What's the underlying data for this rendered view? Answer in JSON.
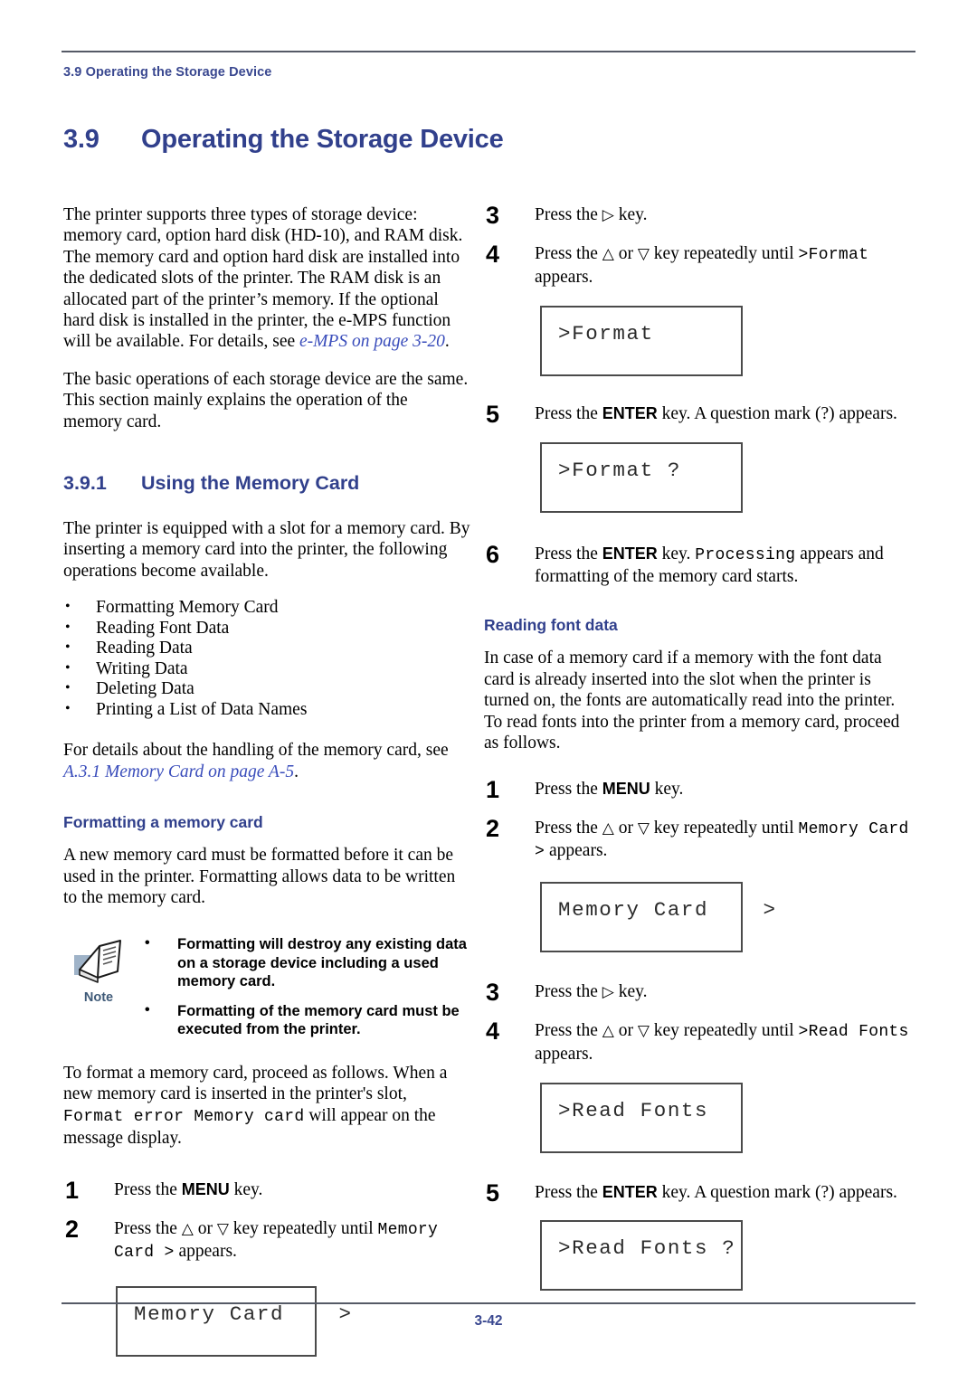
{
  "header": {
    "running_head": "3.9 Operating the Storage Device"
  },
  "section": {
    "number": "3.9",
    "title": "Operating the Storage Device"
  },
  "left_column": {
    "intro_paragraph_1": "The printer supports three types of storage device: memory card, option hard disk (HD-10), and RAM disk. The memory card and option hard disk are installed into the dedicated slots of the printer. The RAM disk is an allocated part of the printer’s memory. If the optional hard disk is installed in the printer, the e-MPS function will be available. For details, see ",
    "intro_xref_1": "e-MPS on page 3-20",
    "intro_paragraph_1_end": ".",
    "intro_paragraph_2": "The basic operations of each storage device are the same. This section mainly explains the operation of the memory card.",
    "subsection": {
      "number": "3.9.1",
      "title": "Using the Memory Card"
    },
    "using_paragraph": "The printer is equipped with a slot for a memory card. By inserting a memory card into the printer, the following operations become available.",
    "operations": [
      "Formatting Memory Card",
      "Reading Font Data",
      "Reading Data",
      "Writing Data",
      "Deleting Data",
      "Printing a List of Data Names"
    ],
    "handling_text_start": " For details about the handling of the memory card, see ",
    "handling_xref": "A.3.1 Memory Card on page A-5",
    "handling_text_end": ".",
    "formatting_heading": "Formatting a memory card",
    "formatting_paragraph": "A new memory card must be formatted before it can be used in the printer. Formatting allows data to be written to the memory card.",
    "note": {
      "icon_name": "note-book-icon",
      "label": "Note",
      "items": [
        "Formatting will destroy any existing data on a storage device including a used memory card.",
        "Formatting of the memory card must be executed from the printer."
      ]
    },
    "format_intro_a": "To format a memory card, proceed as follows. When a new memory card is inserted in the printer's slot, ",
    "format_intro_mono1": "Format error Memory card",
    "format_intro_b": " will appear on the message display.",
    "steps": [
      {
        "number": "1",
        "text_a": "Press the ",
        "kbd": "MENU",
        "text_b": " key."
      },
      {
        "number": "2",
        "text_a": "Press the ",
        "up_arrow": "△",
        "or": " or ",
        "down_arrow": "▽",
        "text_b": " key repeatedly until ",
        "mono": "Memory Card >",
        "text_c": " appears."
      }
    ],
    "lcd_display": "Memory Card    >"
  },
  "right_column": {
    "steps_format": [
      {
        "number": "3",
        "text_a": "Press the ",
        "right_arrow": "▷",
        "text_b": " key."
      },
      {
        "number": "4",
        "text_a": "Press the ",
        "up_arrow": "△",
        "or": " or ",
        "down_arrow": "▽",
        "text_b": " key repeatedly until ",
        "mono": ">Format",
        "text_c": " appears."
      },
      {
        "number": "5",
        "text_a": "Press the ",
        "kbd": "ENTER",
        "text_b": " key. A question mark (?) appears."
      },
      {
        "number": "6",
        "text_a": "Press the ",
        "kbd": "ENTER",
        "text_b": " key. ",
        "mono": "Processing",
        "text_c": " appears and formatting of the memory card starts."
      }
    ],
    "lcd_format": ">Format",
    "lcd_format_q": ">Format ?",
    "reading_heading": "Reading font data",
    "reading_paragraph": "In case of a memory card if a memory with the font data card is already inserted into the slot when the printer is turned on, the fonts are automatically read into the printer. To read fonts into the printer from a memory card, proceed as follows.",
    "steps_read": [
      {
        "number": "1",
        "text_a": "Press the ",
        "kbd": "MENU",
        "text_b": " key."
      },
      {
        "number": "2",
        "text_a": "Press the ",
        "up_arrow": "△",
        "or": " or ",
        "down_arrow": "▽",
        "text_b": " key repeatedly until ",
        "mono": "Memory Card >",
        "text_c": " appears."
      },
      {
        "number": "3",
        "text_a": "Press the ",
        "right_arrow": "▷",
        "text_b": " key."
      },
      {
        "number": "4",
        "text_a": "Press the ",
        "up_arrow": "△",
        "or": " or ",
        "down_arrow": "▽",
        "text_b": " key repeatedly until ",
        "mono": ">Read Fonts",
        "text_c": " appears."
      },
      {
        "number": "5",
        "text_a": "Press the ",
        "kbd": "ENTER",
        "text_b": " key. A question mark (?) appears."
      }
    ],
    "lcd_memory_card": "Memory Card    >",
    "lcd_read_fonts": ">Read Fonts",
    "lcd_read_fonts_q": ">Read Fonts ?"
  },
  "footer": {
    "page_number": "3-42"
  },
  "colors": {
    "heading_blue": "#31408C",
    "xref_blue": "#3A4DBB",
    "rule_gray": "#555A66",
    "note_label_blue": "#3F5A78"
  }
}
